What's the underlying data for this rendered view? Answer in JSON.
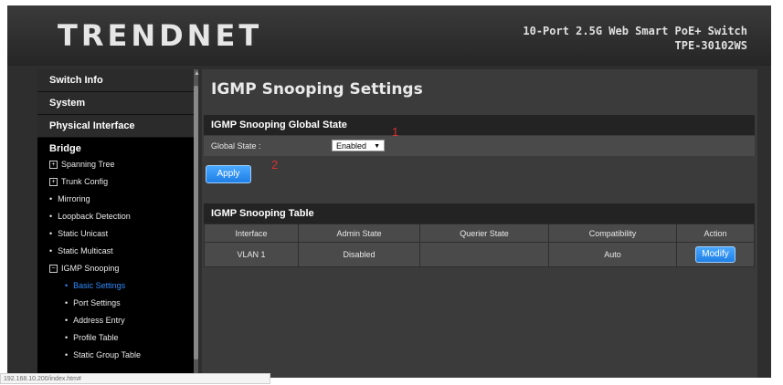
{
  "header": {
    "logo": "TRENDNET",
    "product_name": "10-Port 2.5G Web Smart PoE+ Switch",
    "model": "TPE-30102WS"
  },
  "sidebar": {
    "sections": [
      "Switch Info",
      "System",
      "Physical Interface"
    ],
    "bridge": "Bridge",
    "items": [
      {
        "label": "Spanning Tree",
        "marker": "⊞"
      },
      {
        "label": "Trunk Config",
        "marker": "⊞"
      },
      {
        "label": "Mirroring",
        "marker": "•"
      },
      {
        "label": "Loopback Detection",
        "marker": "•"
      },
      {
        "label": "Static Unicast",
        "marker": "•"
      },
      {
        "label": "Static Multicast",
        "marker": "•"
      },
      {
        "label": "IGMP Snooping",
        "marker": "⊟"
      }
    ],
    "sub_items": [
      {
        "label": "Basic Settings",
        "marker": "•"
      },
      {
        "label": "Port Settings",
        "marker": "•"
      },
      {
        "label": "Address Entry",
        "marker": "•"
      },
      {
        "label": "Profile Table",
        "marker": "•"
      },
      {
        "label": "Static Group Table",
        "marker": "•"
      }
    ]
  },
  "main": {
    "title": "IGMP Snooping Settings",
    "global": {
      "heading": "IGMP Snooping Global State",
      "field_label": "Global State :",
      "selected": "Enabled",
      "apply_label": "Apply"
    },
    "annotations": {
      "one": "1",
      "two": "2"
    },
    "table": {
      "heading": "IGMP Snooping Table",
      "columns": [
        "Interface",
        "Admin State",
        "Querier State",
        "Compatibility",
        "Action"
      ],
      "rows": [
        {
          "interface": "VLAN 1",
          "admin_state": "Disabled",
          "querier_state": "",
          "compatibility": "Auto",
          "action": "Modify"
        }
      ]
    }
  },
  "status_bar": {
    "url": "192.168.10.200/index.htm#"
  },
  "colors": {
    "accent": "#2f8bff",
    "annotation": "#d93030",
    "background": "#3b3b3b"
  }
}
